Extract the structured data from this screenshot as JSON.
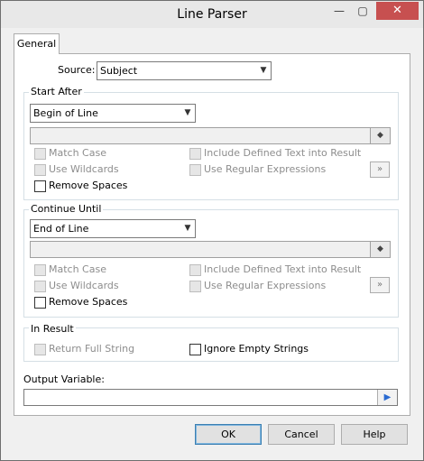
{
  "window": {
    "title": "Line Parser",
    "minimize_glyph": "—",
    "maximize_glyph": "▢",
    "close_glyph": "✕"
  },
  "tabs": [
    {
      "label": "General"
    }
  ],
  "source": {
    "label": "Source:",
    "value": "Subject"
  },
  "start_after": {
    "title": "Start After",
    "combo_value": "Begin of Line",
    "match_case": "Match Case",
    "use_wildcards": "Use Wildcards",
    "include_defined": "Include Defined Text into Result",
    "use_regex": "Use Regular Expressions",
    "remove_spaces": "Remove Spaces",
    "more_glyph": "»"
  },
  "continue_until": {
    "title": "Continue Until",
    "combo_value": "End of Line",
    "match_case": "Match Case",
    "use_wildcards": "Use Wildcards",
    "include_defined": "Include Defined Text into Result",
    "use_regex": "Use Regular Expressions",
    "remove_spaces": "Remove Spaces",
    "more_glyph": "»"
  },
  "in_result": {
    "title": "In Result",
    "return_full": "Return Full String",
    "ignore_empty": "Ignore Empty Strings"
  },
  "output": {
    "label": "Output Variable:",
    "value": ""
  },
  "buttons": {
    "ok": "OK",
    "cancel": "Cancel",
    "help": "Help"
  },
  "icons": {
    "eraser": "◆",
    "play": "▶",
    "dropdown": "▼"
  }
}
